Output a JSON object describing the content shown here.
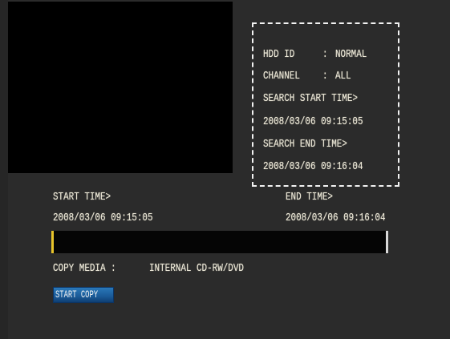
{
  "info": {
    "hdd_id_label": "HDD ID",
    "hdd_id_sep": ":",
    "hdd_id_value": "NORMAL",
    "channel_label": "CHANNEL",
    "channel_sep": ":",
    "channel_value": "ALL",
    "search_start_label": "SEARCH START TIME>",
    "search_start_value": "2008/03/06 09:15:05",
    "search_end_label": "SEARCH END   TIME>",
    "search_end_value": "2008/03/06 09:16:04"
  },
  "range": {
    "start_label": "START TIME>",
    "start_value": "2008/03/06 09:15:05",
    "end_label": "END   TIME>",
    "end_value": "2008/03/06 09:16:04"
  },
  "progress": {
    "fraction": 0.0
  },
  "copy": {
    "media_label": "COPY MEDIA :",
    "media_value": "INTERNAL CD-RW/DVD",
    "start_button": "START COPY"
  },
  "colors": {
    "text": "#ece8d8",
    "progress_marker": "#e8c42a",
    "button": "#1a5a98"
  }
}
